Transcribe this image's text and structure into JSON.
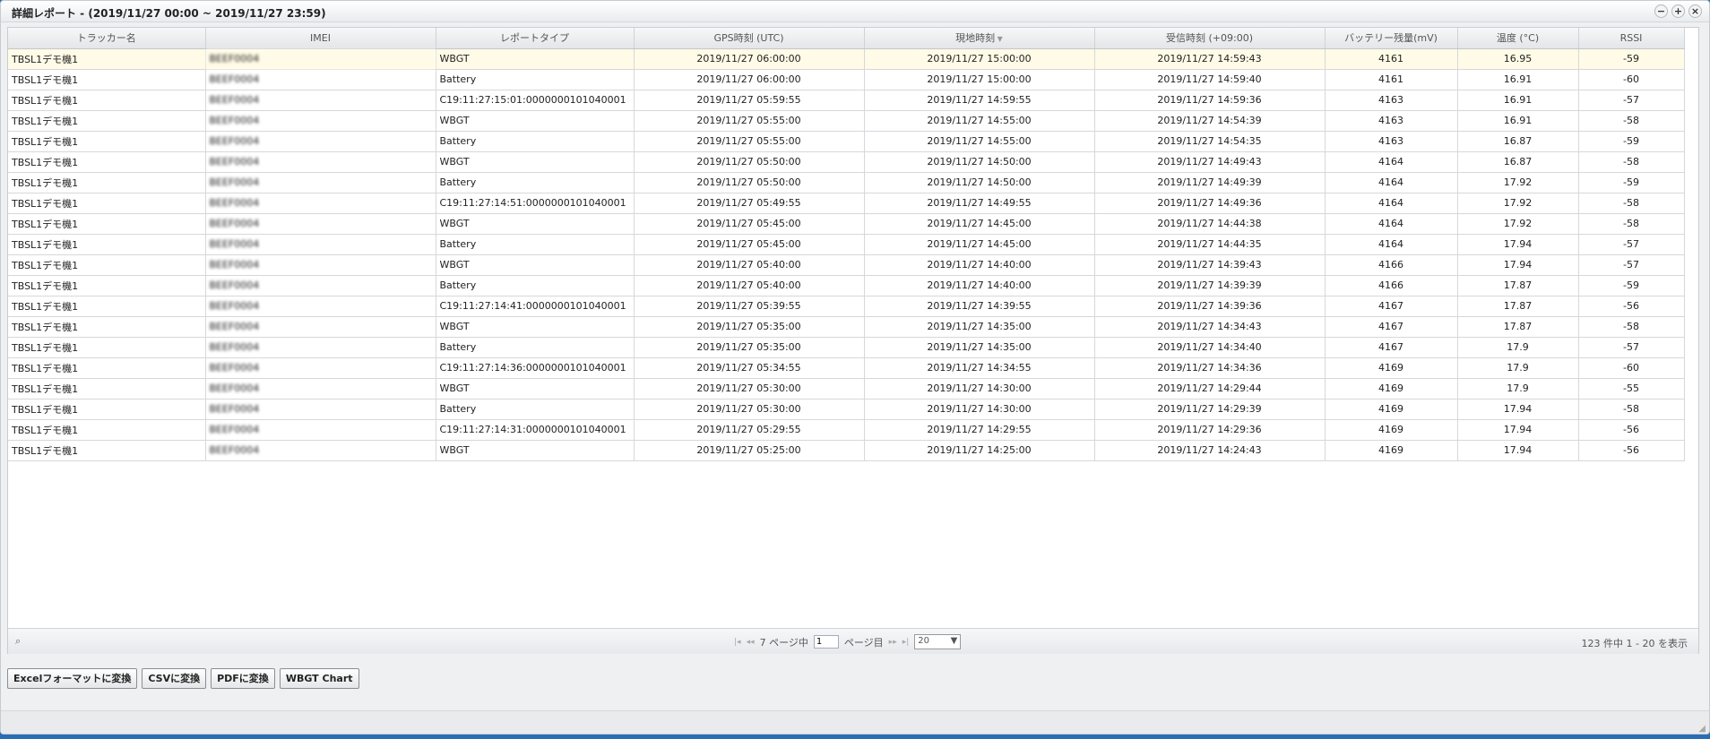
{
  "window": {
    "title": "詳細レポート - (2019/11/27 00:00 ~ 2019/11/27 23:59)",
    "controls": [
      "−",
      "+",
      "×"
    ]
  },
  "columns": [
    "トラッカー名",
    "IMEI",
    "レポートタイプ",
    "GPS時刻 (UTC)",
    "現地時刻",
    "受信時刻 (+09:00)",
    "バッテリー残量(mV)",
    "温度 (°C)",
    "RSSI"
  ],
  "rows": [
    [
      "TBSL1デモ機1",
      "BEEF0004",
      "WBGT",
      "2019/11/27 06:00:00",
      "2019/11/27 15:00:00",
      "2019/11/27 14:59:43",
      "4161",
      "16.95",
      "-59"
    ],
    [
      "TBSL1デモ機1",
      "BEEF0004",
      "Battery",
      "2019/11/27 06:00:00",
      "2019/11/27 15:00:00",
      "2019/11/27 14:59:40",
      "4161",
      "16.91",
      "-60"
    ],
    [
      "TBSL1デモ機1",
      "BEEF0004",
      "C19:11:27:15:01:0000000101040001",
      "2019/11/27 05:59:55",
      "2019/11/27 14:59:55",
      "2019/11/27 14:59:36",
      "4163",
      "16.91",
      "-57"
    ],
    [
      "TBSL1デモ機1",
      "BEEF0004",
      "WBGT",
      "2019/11/27 05:55:00",
      "2019/11/27 14:55:00",
      "2019/11/27 14:54:39",
      "4163",
      "16.91",
      "-58"
    ],
    [
      "TBSL1デモ機1",
      "BEEF0004",
      "Battery",
      "2019/11/27 05:55:00",
      "2019/11/27 14:55:00",
      "2019/11/27 14:54:35",
      "4163",
      "16.87",
      "-59"
    ],
    [
      "TBSL1デモ機1",
      "BEEF0004",
      "WBGT",
      "2019/11/27 05:50:00",
      "2019/11/27 14:50:00",
      "2019/11/27 14:49:43",
      "4164",
      "16.87",
      "-58"
    ],
    [
      "TBSL1デモ機1",
      "BEEF0004",
      "Battery",
      "2019/11/27 05:50:00",
      "2019/11/27 14:50:00",
      "2019/11/27 14:49:39",
      "4164",
      "17.92",
      "-59"
    ],
    [
      "TBSL1デモ機1",
      "BEEF0004",
      "C19:11:27:14:51:0000000101040001",
      "2019/11/27 05:49:55",
      "2019/11/27 14:49:55",
      "2019/11/27 14:49:36",
      "4164",
      "17.92",
      "-58"
    ],
    [
      "TBSL1デモ機1",
      "BEEF0004",
      "WBGT",
      "2019/11/27 05:45:00",
      "2019/11/27 14:45:00",
      "2019/11/27 14:44:38",
      "4164",
      "17.92",
      "-58"
    ],
    [
      "TBSL1デモ機1",
      "BEEF0004",
      "Battery",
      "2019/11/27 05:45:00",
      "2019/11/27 14:45:00",
      "2019/11/27 14:44:35",
      "4164",
      "17.94",
      "-57"
    ],
    [
      "TBSL1デモ機1",
      "BEEF0004",
      "WBGT",
      "2019/11/27 05:40:00",
      "2019/11/27 14:40:00",
      "2019/11/27 14:39:43",
      "4166",
      "17.94",
      "-57"
    ],
    [
      "TBSL1デモ機1",
      "BEEF0004",
      "Battery",
      "2019/11/27 05:40:00",
      "2019/11/27 14:40:00",
      "2019/11/27 14:39:39",
      "4166",
      "17.87",
      "-59"
    ],
    [
      "TBSL1デモ機1",
      "BEEF0004",
      "C19:11:27:14:41:0000000101040001",
      "2019/11/27 05:39:55",
      "2019/11/27 14:39:55",
      "2019/11/27 14:39:36",
      "4167",
      "17.87",
      "-56"
    ],
    [
      "TBSL1デモ機1",
      "BEEF0004",
      "WBGT",
      "2019/11/27 05:35:00",
      "2019/11/27 14:35:00",
      "2019/11/27 14:34:43",
      "4167",
      "17.87",
      "-58"
    ],
    [
      "TBSL1デモ機1",
      "BEEF0004",
      "Battery",
      "2019/11/27 05:35:00",
      "2019/11/27 14:35:00",
      "2019/11/27 14:34:40",
      "4167",
      "17.9",
      "-57"
    ],
    [
      "TBSL1デモ機1",
      "BEEF0004",
      "C19:11:27:14:36:0000000101040001",
      "2019/11/27 05:34:55",
      "2019/11/27 14:34:55",
      "2019/11/27 14:34:36",
      "4169",
      "17.9",
      "-60"
    ],
    [
      "TBSL1デモ機1",
      "BEEF0004",
      "WBGT",
      "2019/11/27 05:30:00",
      "2019/11/27 14:30:00",
      "2019/11/27 14:29:44",
      "4169",
      "17.9",
      "-55"
    ],
    [
      "TBSL1デモ機1",
      "BEEF0004",
      "Battery",
      "2019/11/27 05:30:00",
      "2019/11/27 14:30:00",
      "2019/11/27 14:29:39",
      "4169",
      "17.94",
      "-58"
    ],
    [
      "TBSL1デモ機1",
      "BEEF0004",
      "C19:11:27:14:31:0000000101040001",
      "2019/11/27 05:29:55",
      "2019/11/27 14:29:55",
      "2019/11/27 14:29:36",
      "4169",
      "17.94",
      "-56"
    ],
    [
      "TBSL1デモ機1",
      "BEEF0004",
      "WBGT",
      "2019/11/27 05:25:00",
      "2019/11/27 14:25:00",
      "2019/11/27 14:24:43",
      "4169",
      "17.94",
      "-56"
    ]
  ],
  "sorted_column_index": 4,
  "pager": {
    "first_icon": "first-page-icon",
    "prev_icon": "prev-page-icon",
    "next_icon": "next-page-icon",
    "last_icon": "last-page-icon",
    "total_pages_label": "7 ページ中",
    "current_page": "1",
    "page_suffix": "ページ目",
    "page_size": "20",
    "record_info": "123 件中 1 - 20 を表示"
  },
  "buttons": {
    "excel": "Excelフォーマットに変換",
    "csv": "CSVに変換",
    "pdf": "PDFに変換",
    "wbgt_chart": "WBGT Chart"
  }
}
